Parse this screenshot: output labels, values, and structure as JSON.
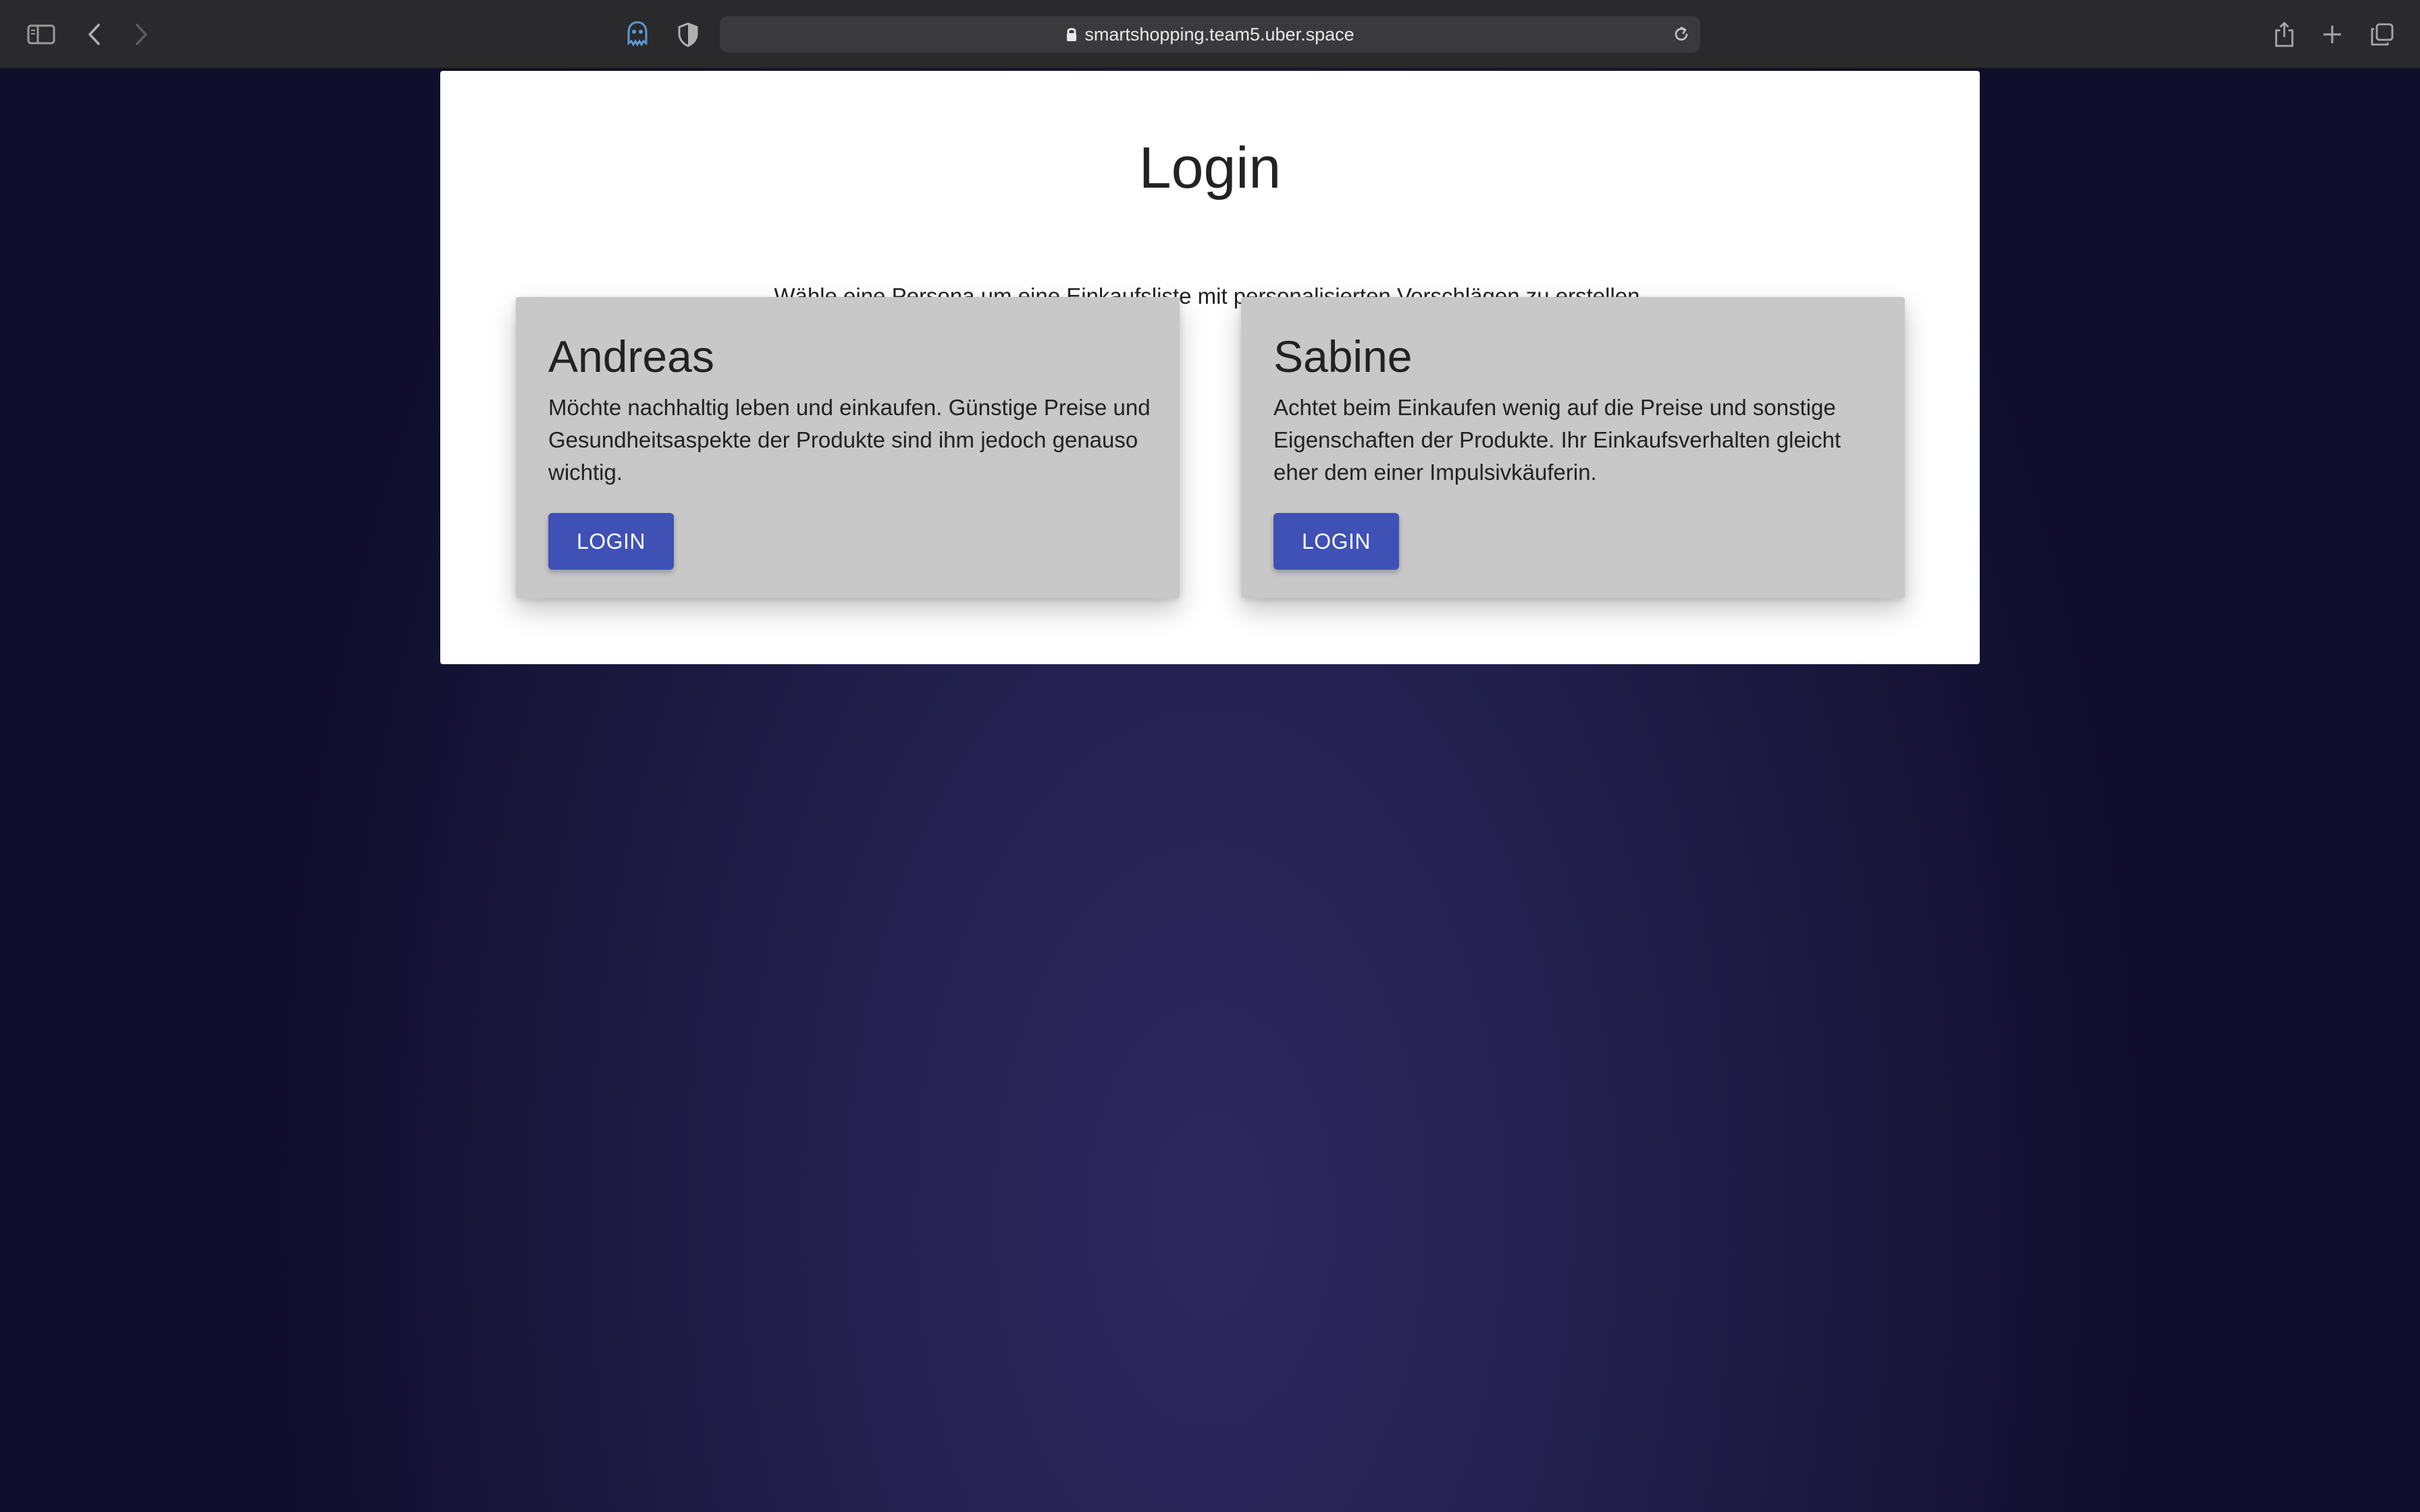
{
  "browser": {
    "url": "smartshopping.team5.uber.space"
  },
  "page": {
    "title": "Login",
    "subtitle": "Wähle eine Persona um eine Einkaufsliste mit personalisierten Vorschlägen zu erstellen."
  },
  "personas": [
    {
      "name": "Andreas",
      "description": "Möchte nachhaltig leben und einkaufen. Günstige Preise und Gesundheitsaspekte der Produkte sind ihm jedoch genauso wichtig.",
      "button_label": "LOGIN"
    },
    {
      "name": "Sabine",
      "description": "Achtet beim Einkaufen wenig auf die Preise und sonstige Eigenschaften der Produkte. Ihr Einkaufsverhalten gleicht eher dem einer Impulsivkäuferin.",
      "button_label": "LOGIN"
    }
  ],
  "colors": {
    "accent": "#3f51b5",
    "card": "#c8c8c8",
    "background": "#221f4c"
  },
  "icons": [
    "sidebar-icon",
    "back-icon",
    "forward-icon",
    "ghostery-icon",
    "shield-icon",
    "lock-icon",
    "reload-icon",
    "share-icon",
    "new-tab-icon",
    "tabs-overview-icon"
  ]
}
